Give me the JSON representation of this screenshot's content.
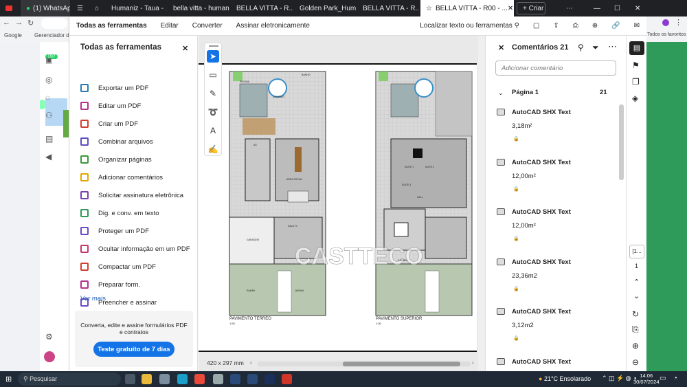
{
  "browser": {
    "tabs": [
      {
        "label": "(1) WhatsApp",
        "active": false
      },
      {
        "label": "Humaniz - Taua - ...",
        "active": false
      },
      {
        "label": "bella vitta - human...",
        "active": false
      },
      {
        "label": "BELLA VITTA - R...",
        "active": false
      },
      {
        "label": "Golden Park_Hum...",
        "active": false
      },
      {
        "label": "BELLA VITTA - R...",
        "active": false
      },
      {
        "label": "BELLA VITTA - R00 - ...",
        "active": true
      }
    ],
    "new_tab_label": "+ Criar",
    "bookmarks": [
      {
        "label": "Google"
      },
      {
        "label": "Gerenciador de..."
      }
    ],
    "all_bookmarks": "Todos os favoritos",
    "wa_badge": "197"
  },
  "acrobat": {
    "menu": [
      {
        "label": "Todas as ferramentas",
        "active": true
      },
      {
        "label": "Editar",
        "active": false
      },
      {
        "label": "Converter",
        "active": false
      },
      {
        "label": "Assinar eletronicamente",
        "active": false
      }
    ],
    "search_label": "Localizar texto ou ferramentas",
    "tools_panel": {
      "title": "Todas as ferramentas",
      "items": [
        {
          "label": "Exportar um PDF",
          "color": "#2a7ab0"
        },
        {
          "label": "Editar um PDF",
          "color": "#b5328a"
        },
        {
          "label": "Criar um PDF",
          "color": "#d2412e"
        },
        {
          "label": "Combinar arquivos",
          "color": "#5b4fc2"
        },
        {
          "label": "Organizar páginas",
          "color": "#3a9a3a"
        },
        {
          "label": "Adicionar comentários",
          "color": "#e0a800"
        },
        {
          "label": "Solicitar assinatura eletrônica",
          "color": "#7b3fb0"
        },
        {
          "label": "Dig. e conv. em texto",
          "color": "#2d9a55"
        },
        {
          "label": "Proteger um PDF",
          "color": "#6a4bc4"
        },
        {
          "label": "Ocultar informação em um PDF",
          "color": "#c23a6d"
        },
        {
          "label": "Compactar um PDF",
          "color": "#d2412e"
        },
        {
          "label": "Preparar form.",
          "color": "#b5328a"
        },
        {
          "label": "Preencher e assinar",
          "color": "#6a4bc4"
        }
      ],
      "more": "Ver mais",
      "promo_text": "Converta, edite e assine formulários PDF e contratos",
      "trial_button": "Teste gratuito de 7 dias"
    },
    "document": {
      "plan_left_label": "PAVIMENTO TERREO",
      "plan_right_label": "PAVIMENTO SUPERIOR",
      "watermark": "CASTTECO",
      "scale": "1:50",
      "room_labels": [
        "PISCINA",
        "GOURMET",
        "BANHO",
        "AS",
        "AREA SOCIAL",
        "SALA TV",
        "GARAGEM",
        "RAMPA",
        "JARDIM",
        "SUITE 1",
        "SUITE 2",
        "SUITE 3",
        "SACADA",
        "HALL"
      ],
      "page_size": "420 x 297 mm",
      "hscroll_pct": 0.55
    },
    "comments": {
      "title": "Comentários 21",
      "input_placeholder": "Adicionar comentário",
      "page_label": "Página 1",
      "page_count": "21",
      "items": [
        {
          "author": "AutoCAD SHX Text",
          "text": "3,18m²"
        },
        {
          "author": "AutoCAD SHX Text",
          "text": "12,00m²"
        },
        {
          "author": "AutoCAD SHX Text",
          "text": "12,00m²"
        },
        {
          "author": "AutoCAD SHX Text",
          "text": "23,36m2"
        },
        {
          "author": "AutoCAD SHX Text",
          "text": "3,12m2"
        },
        {
          "author": "AutoCAD SHX Text",
          "text": ""
        }
      ]
    },
    "rail": {
      "page_box": "[1...",
      "page_num": "1"
    }
  },
  "taskbar": {
    "search": "Pesquisar",
    "weather": "21°C  Ensolarado",
    "time": "14:06",
    "date": "30/07/2024"
  }
}
